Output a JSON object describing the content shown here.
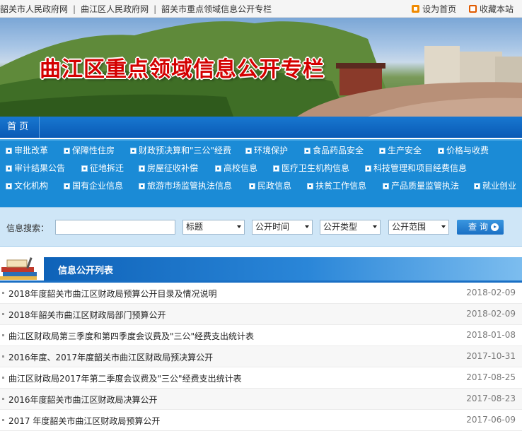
{
  "top_links": [
    "韶关市人民政府网",
    "曲江区人民政府网",
    "韶关市重点领域信息公开专栏"
  ],
  "top_right": {
    "set_home": "设为首页",
    "bookmark": "收藏本站"
  },
  "banner": {
    "title": "曲江区重点领域信息公开专栏"
  },
  "nav": {
    "home": "首 页"
  },
  "categories": [
    [
      "审批改革",
      "保障性住房",
      "财政预决算和\"三公\"经费",
      "环境保护",
      "食品药品安全",
      "生产安全",
      "价格与收费"
    ],
    [
      "审计结果公告",
      "征地拆迁",
      "房屋征收补偿",
      "高校信息",
      "医疗卫生机构信息",
      "科技管理和项目经费信息"
    ],
    [
      "文化机构",
      "国有企业信息",
      "旅游市场监管执法信息",
      "民政信息",
      "扶贫工作信息",
      "产品质量监管执法",
      "就业创业"
    ]
  ],
  "search": {
    "label": "信息搜索：",
    "input_value": "",
    "field_select": "标题",
    "time_select": "公开时间",
    "type_select": "公开类型",
    "scope_select": "公开范围",
    "button": "查 询"
  },
  "list": {
    "title": "信息公开列表",
    "items": [
      {
        "title": "2018年度韶关市曲江区财政局预算公开目录及情况说明",
        "date": "2018-02-09"
      },
      {
        "title": "2018年韶关市曲江区财政局部门预算公开",
        "date": "2018-02-09"
      },
      {
        "title": "曲江区财政局第三季度和第四季度会议费及\"三公\"经费支出统计表",
        "date": "2018-01-08"
      },
      {
        "title": "2016年度、2017年度韶关市曲江区财政局预决算公开",
        "date": "2017-10-31"
      },
      {
        "title": "曲江区财政局2017年第二季度会议费及\"三公\"经费支出统计表",
        "date": "2017-08-25"
      },
      {
        "title": "2016年度韶关市曲江区财政局决算公开",
        "date": "2017-08-23"
      },
      {
        "title": "2017 年度韶关市曲江区财政局预算公开",
        "date": "2017-06-09"
      }
    ]
  }
}
